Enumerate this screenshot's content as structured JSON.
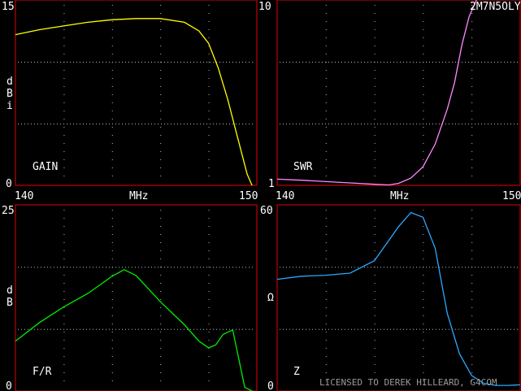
{
  "chart_data": [
    {
      "type": "line",
      "name": "gain",
      "panel_label": "GAIN",
      "y_unit": "dBi",
      "y_ticks": [
        "15",
        "0"
      ],
      "x_ticks": [
        "140",
        "MHz",
        "150"
      ],
      "xlim": [
        140,
        150
      ],
      "ylim": [
        0,
        15
      ],
      "color": "#ffff00",
      "x": [
        140,
        141,
        142,
        143,
        144,
        145,
        146,
        147,
        147.6,
        148,
        148.4,
        148.8,
        149.2,
        149.6,
        149.8
      ],
      "y": [
        12.2,
        12.6,
        12.9,
        13.2,
        13.4,
        13.5,
        13.5,
        13.2,
        12.5,
        11.5,
        9.5,
        6.9,
        3.9,
        0.9,
        0
      ]
    },
    {
      "type": "line",
      "name": "swr",
      "panel_label": "SWR",
      "title": "2M7N5OLY",
      "y_ticks": [
        "10",
        "1"
      ],
      "x_ticks": [
        "140",
        "MHz",
        "150"
      ],
      "xlim": [
        140,
        150
      ],
      "ylim": [
        1,
        10
      ],
      "color": "#ff88ff",
      "x": [
        140,
        141,
        142,
        143,
        144,
        144.6,
        145,
        145.5,
        146,
        146.5,
        147,
        147.3,
        147.6,
        147.9,
        148.2
      ],
      "y": [
        1.3,
        1.25,
        1.18,
        1.12,
        1.05,
        1.02,
        1.1,
        1.35,
        1.9,
        3.0,
        4.7,
        6.0,
        7.8,
        9.2,
        10
      ]
    },
    {
      "type": "line",
      "name": "front-to-back",
      "panel_label": "F/R",
      "y_unit": "dB",
      "y_ticks": [
        "25",
        "0"
      ],
      "x_ticks": [],
      "xlim": [
        140,
        150
      ],
      "ylim": [
        0,
        25
      ],
      "color": "#00ee00",
      "x": [
        140,
        141,
        142,
        143,
        144,
        144.5,
        145,
        146,
        147,
        147.6,
        148,
        148.3,
        148.6,
        149,
        149.5,
        149.8
      ],
      "y": [
        6.7,
        9.2,
        11.3,
        13.1,
        15.4,
        16.3,
        15.5,
        12.0,
        8.9,
        6.7,
        5.8,
        6.2,
        7.6,
        8.2,
        0.5,
        -0.5
      ]
    },
    {
      "type": "line",
      "name": "impedance",
      "panel_label": "Z",
      "y_unit": "Ω",
      "y_ticks": [
        "60",
        "0"
      ],
      "x_ticks": [],
      "xlim": [
        140,
        150
      ],
      "ylim": [
        0,
        60
      ],
      "color": "#2aa8ff",
      "x": [
        140,
        141,
        142,
        143,
        144,
        145,
        145.5,
        146,
        146.5,
        147,
        147.5,
        148,
        148.5,
        149,
        149.5,
        150
      ],
      "y": [
        36,
        37,
        37.3,
        38,
        42,
        53,
        57.5,
        56,
        46,
        25,
        12,
        5,
        2.5,
        1.8,
        1.8,
        2
      ]
    }
  ],
  "footer": {
    "license_text": "LICENSED TO DEREK HILLEARD, G4COM"
  }
}
